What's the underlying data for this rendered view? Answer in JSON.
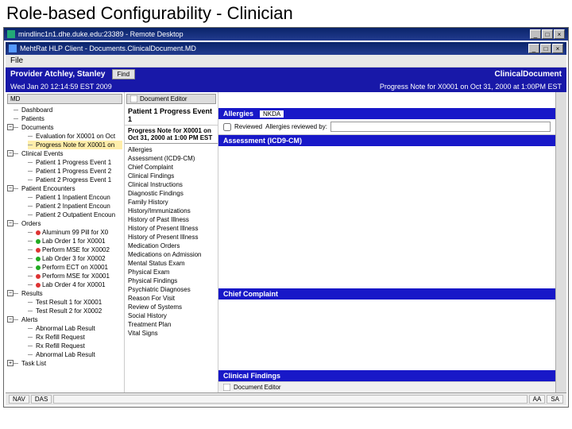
{
  "slide_title": "Role-based Configurability - Clinician",
  "outer_title": "mindlinc1n1.dhe.duke.edu:23389 - Remote Desktop",
  "inner_title": "MehtRat HLP Client - Documents.ClinicalDocument.MD",
  "menu_file": "File",
  "provider": {
    "label": "Provider Atchley, Stanley",
    "find": "Find",
    "right": "ClinicalDocument"
  },
  "datebar": {
    "left": "Wed Jan 20 12:14:59 EST 2009",
    "right": "Progress Note for X0001 on Oct 31, 2000 at 1:00PM EST"
  },
  "nav_hdr": "MD",
  "tree": {
    "dashboard": "Dashboard",
    "patients": "Patients",
    "documents": "Documents",
    "doc1": "Evaluation for X0001 on Oct",
    "doc2": "Progress Note for X0001 on",
    "clinical_events": "Clinical Events",
    "ce1": "Patient 1 Progress Event 1",
    "ce2": "Patient 1 Progress Event 2",
    "ce3": "Patient 2 Progress Event 1",
    "encounters": "Patient Encounters",
    "en1": "Patient 1 Inpatient Encoun",
    "en2": "Patient 2 Inpatient Encoun",
    "en3": "Patient 2 Outpatient Encoun",
    "orders": "Orders",
    "o1": "Aluminum 99 Pill for X0",
    "o2": "Lab Order 1 for X0001",
    "o3": "Perform MSE for X0002",
    "o4": "Lab Order 3 for X0002",
    "o5": "Perform ECT on X0001",
    "o6": "Perform MSE for X0001",
    "o7": "Lab Order 4 for X0001",
    "results": "Results",
    "r1": "Test Result 1 for X0001",
    "r2": "Test Result 2 for X0002",
    "alerts": "Alerts",
    "a1": "Abnormal Lab Result",
    "a2": "Rx Refill Request",
    "a3": "Rx Refill Request",
    "a4": "Abnormal Lab Result",
    "tasklist": "Task List"
  },
  "doc_editor_tab": "Document Editor",
  "patient_hdr": "Patient 1 Progress Event 1",
  "patient_sub": "Progress Note for X0001 on Oct 31, 2000 at 1:00 PM EST",
  "sections": [
    "Allergies",
    "Assessment (ICD9-CM)",
    "Chief Complaint",
    "Clinical Findings",
    "Clinical Instructions",
    "Diagnostic Findings",
    "Family History",
    "History/Immunizations",
    "History of Past Illness",
    "History of Present Illness",
    "History of Present Illness",
    "Medication Orders",
    "Medications on Admission",
    "Mental Status Exam",
    "Physical Exam",
    "Physical Findings",
    "Psychiatric Diagnoses",
    "Reason For Visit",
    "Review of Systems",
    "Social History",
    "Treatment Plan",
    "Vital Signs"
  ],
  "bands": {
    "allergies": "Allergies",
    "nkda": "NKDA",
    "reviewed": "Reviewed",
    "reviewed_by": "Allergies reviewed by:",
    "assessment": "Assessment (ICD9-CM)",
    "chief": "Chief Complaint",
    "clinfind": "Clinical Findings"
  },
  "bottom_tab": "Document Editor",
  "status": {
    "l1": "NAV",
    "l2": "DAS",
    "r1": "AA",
    "r2": "SA"
  }
}
